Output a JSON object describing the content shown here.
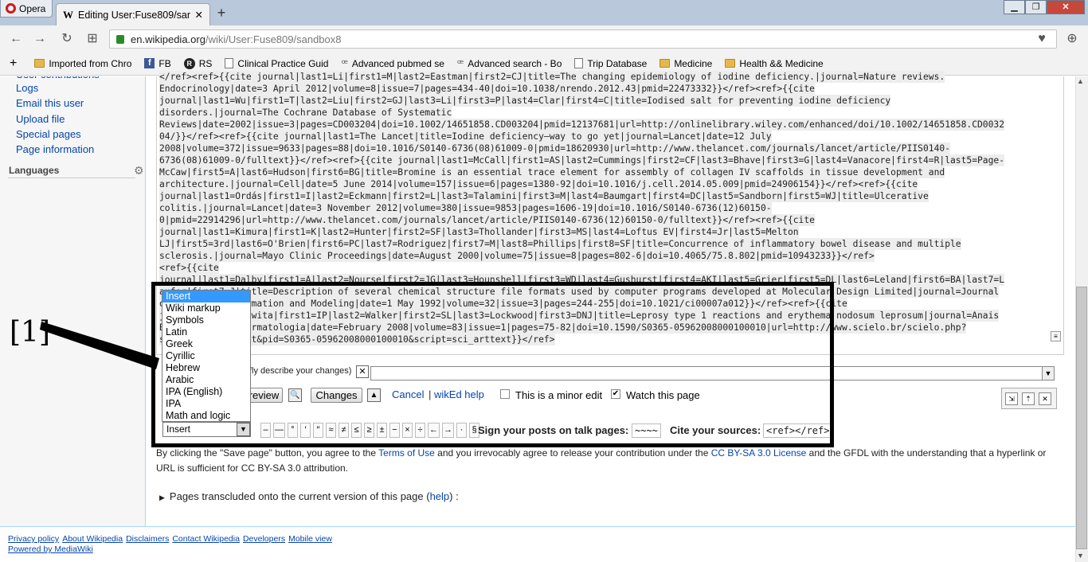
{
  "browser": {
    "opera_label": "Opera",
    "tab_title": "Editing User:Fuse809/sandbox8",
    "url_host": "en.wikipedia.org",
    "url_path": "/wiki/User:Fuse809/sandbox8"
  },
  "bookmarks": [
    {
      "label": "Imported from Chro",
      "icon": "folder-icon"
    },
    {
      "label": "FB",
      "icon": "facebook-icon"
    },
    {
      "label": "RS",
      "icon": "rs-icon"
    },
    {
      "label": "Clinical Practice Guid",
      "icon": "page-icon"
    },
    {
      "label": "Advanced pubmed se",
      "icon": "pubmed-icon"
    },
    {
      "label": "Advanced search - Bo",
      "icon": "pubmed-icon"
    },
    {
      "label": "Trip Database",
      "icon": "page-icon"
    },
    {
      "label": "Medicine",
      "icon": "folder-icon"
    },
    {
      "label": "Health && Medicine",
      "icon": "folder-icon"
    }
  ],
  "sidebar": {
    "cut_item": "User contributions",
    "items": [
      "Logs",
      "Email this user",
      "Upload file",
      "Special pages",
      "Page information"
    ],
    "languages": "Languages"
  },
  "editor_lines": [
    "</ref><ref>{{cite journal|last1=Li|first1=M|last2=Eastman|first2=CJ|title=The changing epidemiology of iodine deficiency.|journal=Nature reviews.",
    "Endocrinology|date=3 April 2012|volume=8|issue=7|pages=434-40|doi=10.1038/nrendo.2012.43|pmid=22473332}}</ref><ref>{{cite",
    "journal|last1=Wu|first1=T|last2=Liu|first2=GJ|last3=Li|first3=P|last4=Clar|first4=C|title=Iodised salt for preventing iodine deficiency",
    "disorders.|journal=The Cochrane Database of Systematic",
    "Reviews|date=2002|issue=3|pages=CD003204|doi=10.1002/14651858.CD003204|pmid=12137681|url=http://onlinelibrary.wiley.com/enhanced/doi/10.1002/14651858.CD0032",
    "04/}}</ref><ref>{{cite journal|last1=The Lancet|title=Iodine deficiency—way to go yet|journal=Lancet|date=12 July",
    "2008|volume=372|issue=9633|pages=88|doi=10.1016/S0140-6736(08)61009-0|pmid=18620930|url=http://www.thelancet.com/journals/lancet/article/PIIS0140-",
    "6736(08)61009-0/fulltext}}</ref><ref>{{cite journal|last1=McCall|first1=AS|last2=Cummings|first2=CF|last3=Bhave|first3=G|last4=Vanacore|first4=R|last5=Page-",
    "McCaw|first5=A|last6=Hudson|first6=BG|title=Bromine is an essential trace element for assembly of collagen IV scaffolds in tissue development and",
    "architecture.|journal=Cell|date=5 June 2014|volume=157|issue=6|pages=1380-92|doi=10.1016/j.cell.2014.05.009|pmid=24906154}}</ref><ref>{{cite",
    "journal|last1=Ordás|first1=I|last2=Eckmann|first2=L|last3=Talamini|first3=M|last4=Baumgart|first4=DC|last5=Sandborn|first5=WJ|title=Ulcerative",
    "colitis.|journal=Lancet|date=3 November 2012|volume=380|issue=9853|pages=1606-19|doi=10.1016/S0140-6736(12)60150-",
    "0|pmid=22914296|url=http://www.thelancet.com/journals/lancet/article/PIIS0140-6736(12)60150-0/fulltext}}</ref><ref>{{cite",
    "journal|last1=Kimura|first1=K|last2=Hunter|first2=SF|last3=Thollander|first3=MS|last4=Loftus EV|first4=Jr|last5=Melton",
    "LJ|first5=3rd|last6=O'Brien|first6=PC|last7=Rodriguez|first7=M|last8=Phillips|first8=SF|title=Concurrence of inflammatory bowel disease and multiple",
    "sclerosis.|journal=Mayo Clinic Proceedings|date=August 2000|volume=75|issue=8|pages=802-6|doi=10.4065/75.8.802|pmid=10943233}}</ref>",
    "<ref>{{cite",
    "journal|last1=Dalby|first1=A|last2=Nourse|first2=JG|last3=Hounshell|first3=WD|last4=Gushurst|first4=AKI|last5=Grier|first5=DL|last6=Leland|first6=BA|last7=L",
    "aufer|first7=J|title=Description of several chemical structure file formats used by computer programs developed at Molecular Design Limited|journal=Journal",
    "of Chemical Information and Modeling|date=1 May 1992|volume=32|issue=3|pages=244-255|doi=10.1021/ci00007a012}}</ref><ref>{{cite",
    "journal|last1=Shawita|first1=IP|last2=Walker|first2=SL|last3=Lockwood|first3=DNJ|title=Leprosy type 1 reactions and erythema nodosum leprosum|journal=Anais",
    "Brasileiros de Dermatologia|date=February 2008|volume=83|issue=1|pages=75-82|doi=10.1590/S0365-05962008000100010|url=http://www.scielo.br/scielo.php?",
    "script=sci_arttext&pid=S0365-05962008000100010&script=sci_arttext}}</ref>"
  ],
  "summary": {
    "label": "Summary: (Briefly describe your changes)",
    "visible_label": "fly describe your changes)",
    "value": ""
  },
  "buttons": {
    "preview": "review",
    "changes": "Changes",
    "cancel": "Cancel",
    "separator": "|",
    "wiked_help": "wikEd help",
    "minor": "This is a minor edit",
    "watch": "Watch this page",
    "minor_checked": false,
    "watch_checked": true
  },
  "insert": {
    "selected": "Insert",
    "options": [
      "Insert",
      "Wiki markup",
      "Symbols",
      "Latin",
      "Greek",
      "Cyrillic",
      "Hebrew",
      "Arabic",
      "IPA (English)",
      "IPA",
      "Math and logic"
    ],
    "chars": [
      "–",
      "—",
      "°",
      "′",
      "″",
      "≈",
      "≠",
      "≤",
      "≥",
      "±",
      "−",
      "×",
      "÷",
      "←",
      "→",
      "·",
      "§"
    ]
  },
  "sign": {
    "label": "Sign your posts on talk pages:",
    "code": "~~~~"
  },
  "cite": {
    "label": "Cite your sources:",
    "code": "<ref></ref>"
  },
  "annotation": {
    "label": "[1]"
  },
  "legal": {
    "p1": "By clicking the \"Save page\" button, you agree to the ",
    "terms": "Terms of Use",
    "p2": " and you irrevocably agree to release your contribution under the ",
    "license": "CC BY-SA 3.0 License",
    "p3": " and the GFDL with the understanding that a hyperlink or URL is sufficient for CC BY-SA 3.0 attribution."
  },
  "transcluded": {
    "text": "Pages transcluded onto the current version of this page (",
    "help": "help",
    "end": ") :"
  },
  "footer": {
    "links": [
      "Privacy policy",
      "About Wikipedia",
      "Disclaimers",
      "Contact Wikipedia",
      "Developers",
      "Mobile view"
    ],
    "powered": "Powered by MediaWiki"
  },
  "colors": {
    "link": "#0645ad",
    "frame": "#000000",
    "dropdown_highlight": "#3399ff"
  }
}
